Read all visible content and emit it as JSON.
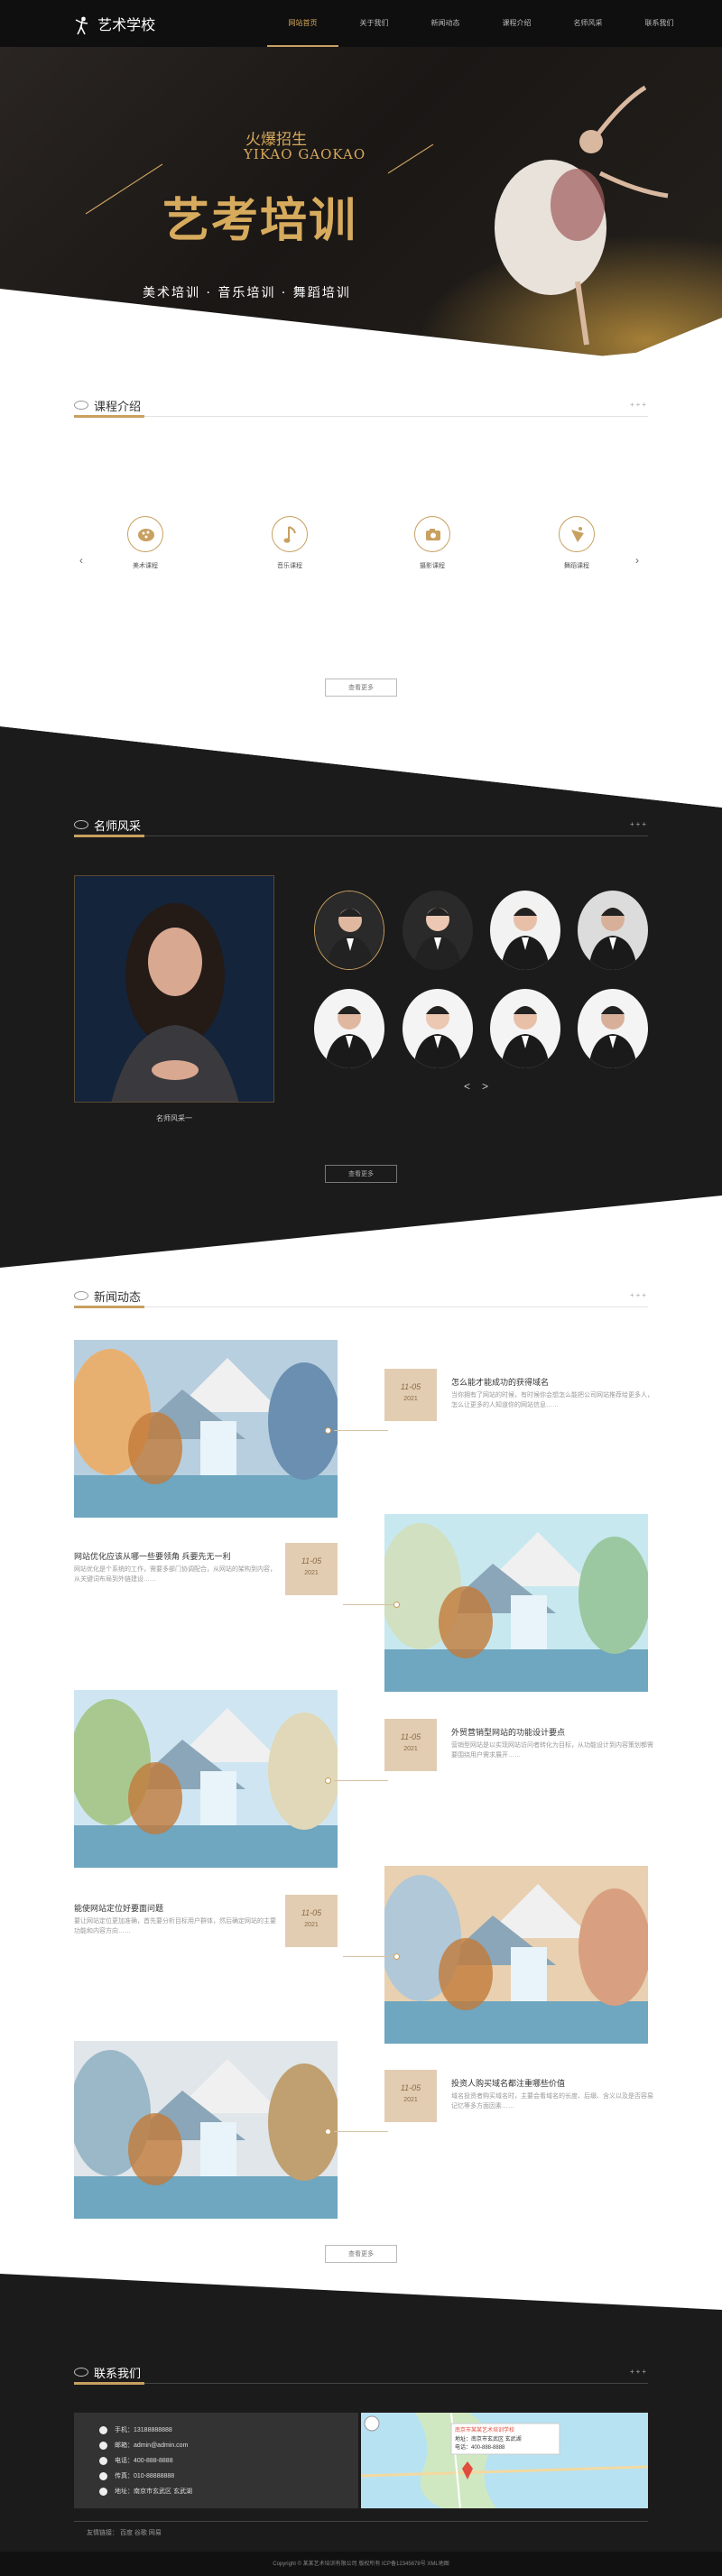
{
  "nav": {
    "logo": "艺术学校",
    "items": [
      "网站首页",
      "关于我们",
      "新闻动态",
      "课程介绍",
      "名师风采",
      "联系我们"
    ]
  },
  "hero": {
    "small_title": "火爆招生",
    "en_title": "YIKAO GAOKAO",
    "big_title": "艺考培训",
    "subtitle": "美术培训 · 音乐培训 · 舞蹈培训"
  },
  "courses": {
    "title": "课程介绍",
    "more": "+++",
    "items": [
      {
        "label": "美术课程",
        "icon": "palette-icon"
      },
      {
        "label": "音乐课程",
        "icon": "music-note-icon"
      },
      {
        "label": "摄影课程",
        "icon": "camera-icon"
      },
      {
        "label": "舞蹈课程",
        "icon": "dance-icon"
      }
    ],
    "prev": "‹",
    "next": "›",
    "more_button": "查看更多"
  },
  "teachers": {
    "title": "名师风采",
    "more": "+++",
    "featured_caption": "名师风采一",
    "prev": "<",
    "next": ">",
    "more_button": "查看更多"
  },
  "news": {
    "title": "新闻动态",
    "more": "+++",
    "items": [
      {
        "date": "11-05",
        "year": "2021",
        "title": "怎么能才能成功的获得域名",
        "desc": "当你拥有了网站的时候，有时候你会想怎么能把公司网站推荐给更多人，怎么让更多的人知道你的网站信息……"
      },
      {
        "date": "11-05",
        "year": "2021",
        "title": "网站优化应该从哪一些要领角 兵要先无一利",
        "desc": "网站优化是个系统的工作，需要多部门协调配合，从网站的架构到内容，从关键词布局到外链建设……"
      },
      {
        "date": "11-05",
        "year": "2021",
        "title": "外贸营销型网站的功能设计要点",
        "desc": "营销型网站是以实现网站访问者转化为目标，从功能设计到内容策划都需要围绕用户需求展开……"
      },
      {
        "date": "11-05",
        "year": "2021",
        "title": "能使网站定位好要面问题",
        "desc": "要让网站定位更加准确，首先要分析目标用户群体，然后确定网站的主要功能和内容方向……"
      },
      {
        "date": "11-05",
        "year": "2021",
        "title": "投资人购买域名都注重哪些价值",
        "desc": "域名投资者购买域名时，主要会看域名的长度、后缀、含义以及是否容易记忆等多方面因素……"
      }
    ],
    "more_button": "查看更多"
  },
  "contact": {
    "title": "联系我们",
    "more": "+++",
    "rows": [
      {
        "label": "手机：",
        "value": "13188888888"
      },
      {
        "label": "邮箱：",
        "value": "admin@admin.com"
      },
      {
        "label": "电话：",
        "value": "400-888-8888"
      },
      {
        "label": "传真：",
        "value": "010-88888888"
      },
      {
        "label": "地址：",
        "value": "南京市玄武区 玄武湖"
      }
    ],
    "map_address": "地址：南京市玄武区 玄武湖",
    "map_phone": "电话：400-888-8888",
    "map_company": "南京市某某艺术培训学校"
  },
  "footer": {
    "links": "友情链接：  百度  谷歌  网易",
    "copyright": "Copyright © 某某艺术培训有限公司 版权所有 ICP备12345678号 XML地图"
  },
  "colors": {
    "gold": "#c8a060",
    "dark": "#1c1b1b"
  }
}
